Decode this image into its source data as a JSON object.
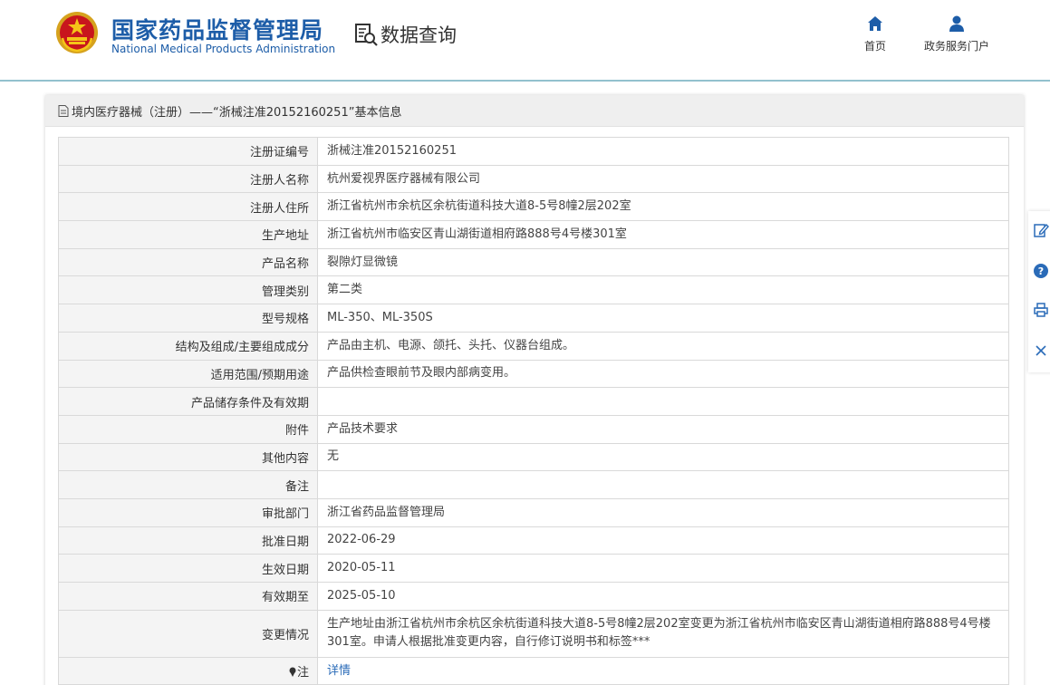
{
  "header": {
    "brand_cn": "国家药品监督管理局",
    "brand_en": "National Medical Products Administration",
    "query_title": "数据查询",
    "nav": [
      {
        "label": "首页",
        "icon": "home-icon"
      },
      {
        "label": "政务服务门户",
        "icon": "user-icon"
      }
    ]
  },
  "panel": {
    "title": "境内医疗器械（注册）——“浙械注准20152160251”基本信息"
  },
  "rows": [
    {
      "key": "注册证编号",
      "value": "浙械注准20152160251"
    },
    {
      "key": "注册人名称",
      "value": "杭州爱视界医疗器械有限公司"
    },
    {
      "key": "注册人住所",
      "value": "浙江省杭州市余杭区余杭街道科技大道8-5号8幢2层202室"
    },
    {
      "key": "生产地址",
      "value": "浙江省杭州市临安区青山湖街道相府路888号4号楼301室"
    },
    {
      "key": "产品名称",
      "value": "裂隙灯显微镜"
    },
    {
      "key": "管理类别",
      "value": "第二类"
    },
    {
      "key": "型号规格",
      "value": "ML-350、ML-350S"
    },
    {
      "key": "结构及组成/主要组成成分",
      "value": "产品由主机、电源、颌托、头托、仪器台组成。"
    },
    {
      "key": "适用范围/预期用途",
      "value": "产品供检查眼前节及眼内部病变用。"
    },
    {
      "key": "产品储存条件及有效期",
      "value": ""
    },
    {
      "key": "附件",
      "value": "产品技术要求"
    },
    {
      "key": "其他内容",
      "value": "无"
    },
    {
      "key": "备注",
      "value": ""
    },
    {
      "key": "审批部门",
      "value": "浙江省药品监督管理局"
    },
    {
      "key": "批准日期",
      "value": "2022-06-29"
    },
    {
      "key": "生效日期",
      "value": "2020-05-11"
    },
    {
      "key": "有效期至",
      "value": "2025-05-10"
    },
    {
      "key": "变更情况",
      "value": "生产地址由浙江省杭州市余杭区余杭街道科技大道8-5号8幢2层202室变更为浙江省杭州市临安区青山湖街道相府路888号4号楼301室。申请人根据批准变更内容，自行修订说明书和标签***"
    }
  ],
  "note": {
    "key": "注",
    "link": "详情"
  },
  "sidebar": [
    "edit-icon",
    "help-icon",
    "print-icon",
    "close-icon"
  ],
  "colors": {
    "brand": "#1d5da8",
    "link": "#2a6bb8",
    "header_line": "#3a8ea5"
  }
}
